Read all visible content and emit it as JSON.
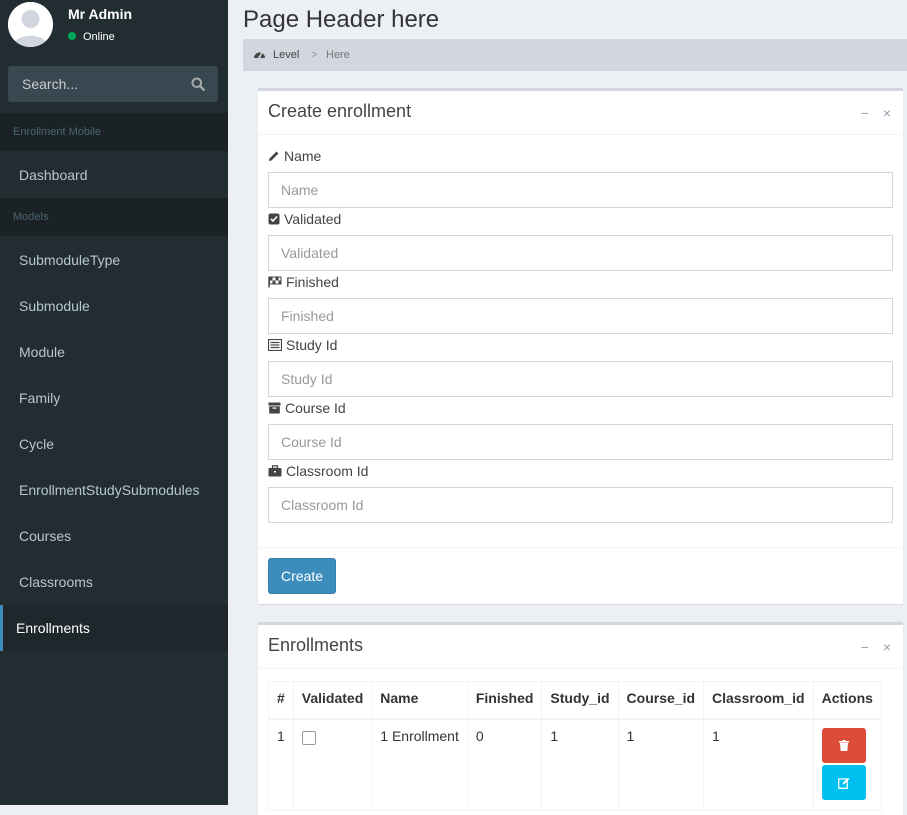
{
  "user": {
    "name": "Mr Admin",
    "status": "Online"
  },
  "search": {
    "placeholder": "Search..."
  },
  "sidebar": {
    "header1": "Enrollment Mobile",
    "dashboard": "Dashboard",
    "header2": "Models",
    "items": [
      {
        "label": "SubmoduleType"
      },
      {
        "label": "Submodule"
      },
      {
        "label": "Module"
      },
      {
        "label": "Family"
      },
      {
        "label": "Cycle"
      },
      {
        "label": "EnrollmentStudySubmodules"
      },
      {
        "label": "Courses"
      },
      {
        "label": "Classrooms"
      },
      {
        "label": "Enrollments"
      }
    ],
    "active_item": "Enrollments"
  },
  "page": {
    "title": "Page Header here"
  },
  "breadcrumb": {
    "level": "Level",
    "separator": ">",
    "here": "Here"
  },
  "create_box": {
    "title": "Create enrollment",
    "collapse": "−",
    "close": "×",
    "fields": [
      {
        "label": "Name",
        "placeholder": "Name",
        "icon": "pencil-icon"
      },
      {
        "label": "Validated",
        "placeholder": "Validated",
        "icon": "check-square-icon"
      },
      {
        "label": "Finished",
        "placeholder": "Finished",
        "icon": "flag-checkered-icon"
      },
      {
        "label": "Study Id",
        "placeholder": "Study Id",
        "icon": "list-alt-icon"
      },
      {
        "label": "Course Id",
        "placeholder": "Course Id",
        "icon": "archive-icon"
      },
      {
        "label": "Classroom Id",
        "placeholder": "Classroom Id",
        "icon": "briefcase-icon"
      }
    ],
    "submit": "Create"
  },
  "list_box": {
    "title": "Enrollments",
    "collapse": "−",
    "close": "×",
    "columns": [
      "#",
      "Validated",
      "Name",
      "Finished",
      "Study_id",
      "Course_id",
      "Classroom_id",
      "Actions"
    ],
    "rows": [
      {
        "id": "1",
        "validated": false,
        "name": "1 Enrollment",
        "finished": "0",
        "study_id": "1",
        "course_id": "1",
        "classroom_id": "1"
      }
    ]
  },
  "colors": {
    "sidebar_bg": "#222d32",
    "primary": "#3c8dbc",
    "danger": "#dd4b39",
    "info": "#00c0ef",
    "online": "#00a65a"
  }
}
